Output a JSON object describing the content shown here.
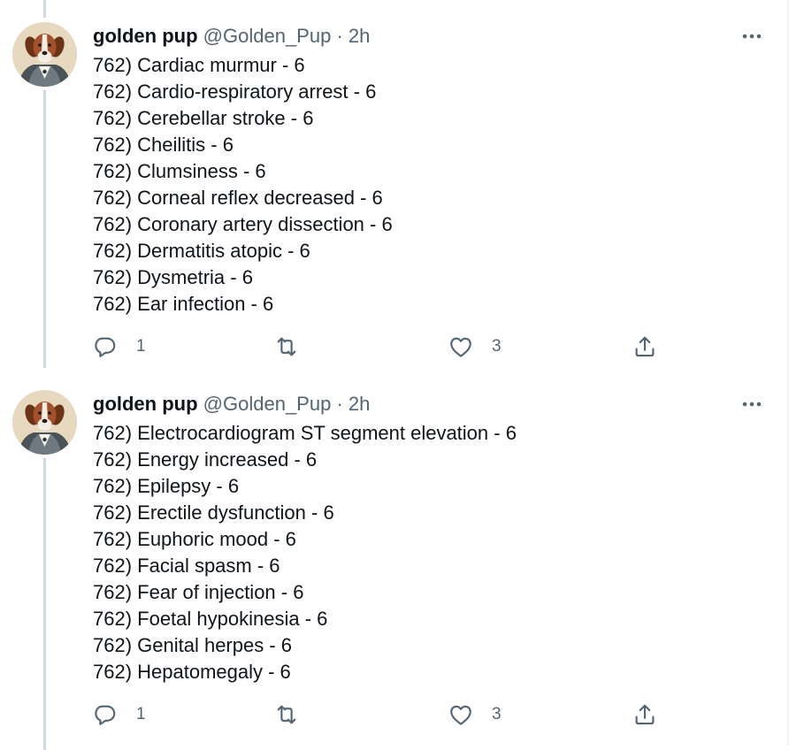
{
  "tweets": [
    {
      "author": {
        "display_name": "golden pup",
        "handle": "@Golden_Pup",
        "separator": "·",
        "time": "2h",
        "avatar_icon": "dog-portrait-avatar"
      },
      "lines": [
        "762) Cardiac murmur - 6",
        "762) Cardio-respiratory arrest - 6",
        "762) Cerebellar stroke - 6",
        "762) Cheilitis - 6",
        "762) Clumsiness - 6",
        "762) Corneal reflex decreased - 6",
        "762) Coronary artery dissection - 6",
        "762) Dermatitis atopic - 6",
        "762) Dysmetria - 6",
        "762) Ear infection - 6"
      ],
      "actions": {
        "reply_count": "1",
        "retweet_count": "",
        "like_count": "3"
      }
    },
    {
      "author": {
        "display_name": "golden pup",
        "handle": "@Golden_Pup",
        "separator": "·",
        "time": "2h",
        "avatar_icon": "dog-portrait-avatar"
      },
      "lines": [
        "762) Electrocardiogram ST segment elevation - 6",
        "762) Energy increased - 6",
        "762) Epilepsy - 6",
        "762) Erectile dysfunction - 6",
        "762) Euphoric mood - 6",
        "762) Facial spasm - 6",
        "762) Fear of injection - 6",
        "762) Foetal hypokinesia - 6",
        "762) Genital herpes - 6",
        "762) Hepatomegaly - 6"
      ],
      "actions": {
        "reply_count": "1",
        "retweet_count": "",
        "like_count": "3"
      }
    }
  ],
  "icons": {
    "reply": "reply-icon",
    "retweet": "retweet-icon",
    "like": "heart-icon",
    "share": "share-icon",
    "more": "more-options-icon"
  },
  "colors": {
    "text": "#0f1419",
    "secondary": "#536471",
    "thread_line": "#cfd9de",
    "border": "#eff3f4"
  }
}
